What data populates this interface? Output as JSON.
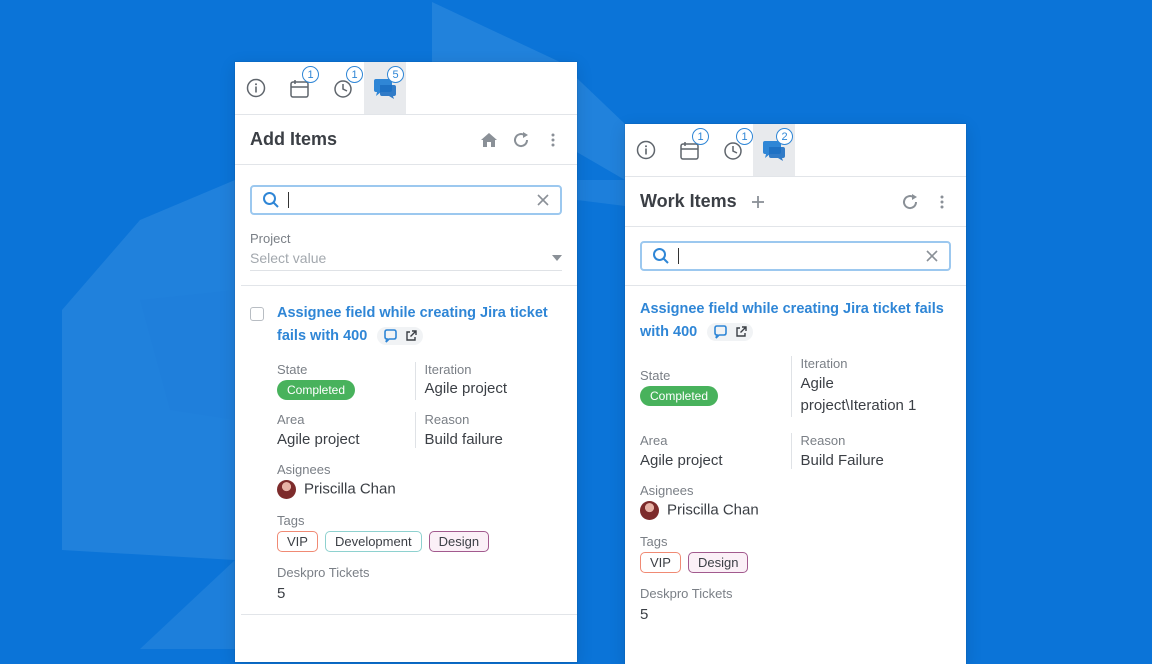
{
  "colors": {
    "background": "#0b74d8",
    "accent": "#2f86d6",
    "status_completed": "#48b25c",
    "tag_vip": "#f08a74",
    "tag_development": "#8ed1cf",
    "tag_design": "#a25a8e"
  },
  "left_panel": {
    "tabs": [
      {
        "icon": "info-icon",
        "badge": ""
      },
      {
        "icon": "calendar-icon",
        "badge": "1"
      },
      {
        "icon": "clock-icon",
        "badge": "1"
      },
      {
        "icon": "chat-icon",
        "badge": "5",
        "active": true
      }
    ],
    "title": "Add Items",
    "header_icons": [
      "home-icon",
      "refresh-icon",
      "more-vertical-icon"
    ],
    "search": {
      "value": "",
      "placeholder": ""
    },
    "project": {
      "label": "Project",
      "placeholder": "Select value"
    },
    "item": {
      "title": "Assignee field while creating  Jira ticket fails with 400",
      "state_label": "State",
      "state_value": "Completed",
      "iteration_label": "Iteration",
      "iteration_value": "Agile project",
      "area_label": "Area",
      "area_value": "Agile project",
      "reason_label": "Reason",
      "reason_value": "Build failure",
      "assignees_label": "Asignees",
      "assignee_name": "Priscilla Chan",
      "tags_label": "Tags",
      "tags": [
        "VIP",
        "Development",
        "Design"
      ],
      "tickets_label": "Deskpro Tickets",
      "tickets_value": "5"
    }
  },
  "right_panel": {
    "tabs": [
      {
        "icon": "info-icon",
        "badge": ""
      },
      {
        "icon": "calendar-icon",
        "badge": "1"
      },
      {
        "icon": "clock-icon",
        "badge": "1"
      },
      {
        "icon": "chat-icon",
        "badge": "2",
        "active": true
      }
    ],
    "title": "Work Items",
    "header_icons": [
      "plus-icon",
      "refresh-icon",
      "more-vertical-icon"
    ],
    "search": {
      "value": "",
      "placeholder": ""
    },
    "item": {
      "title": "Assignee field while creating  Jira ticket fails with 400",
      "state_label": "State",
      "state_value": "Completed",
      "iteration_label": "Iteration",
      "iteration_value_line1": "Agile",
      "iteration_value_line2": "project\\Iteration 1",
      "area_label": "Area",
      "area_value": "Agile project",
      "reason_label": "Reason",
      "reason_value": "Build Failure",
      "assignees_label": "Asignees",
      "assignee_name": "Priscilla Chan",
      "tags_label": "Tags",
      "tags": [
        "VIP",
        "Design"
      ],
      "tickets_label": "Deskpro Tickets",
      "tickets_value": "5"
    }
  }
}
